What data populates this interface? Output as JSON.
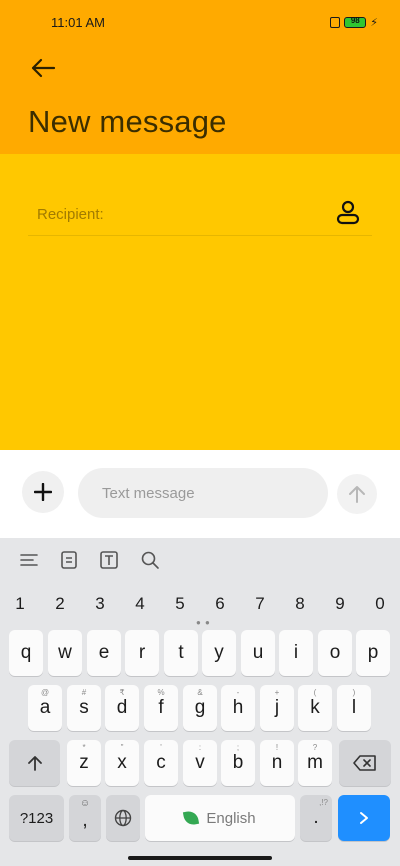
{
  "status_bar": {
    "time": "11:01 AM",
    "battery": "98"
  },
  "header": {
    "title": "New message"
  },
  "recipient": {
    "label": "Recipient:"
  },
  "composer": {
    "placeholder": "Text message"
  },
  "keyboard": {
    "numbers": [
      "1",
      "2",
      "3",
      "4",
      "5",
      "6",
      "7",
      "8",
      "9",
      "0"
    ],
    "row1": [
      "q",
      "w",
      "e",
      "r",
      "t",
      "y",
      "u",
      "i",
      "o",
      "p"
    ],
    "row2": [
      "a",
      "s",
      "d",
      "f",
      "g",
      "h",
      "j",
      "k",
      "l"
    ],
    "row2_hints": [
      "@",
      "#",
      "₹",
      "%",
      "&",
      "-",
      "+",
      "(",
      ")"
    ],
    "row3": [
      "z",
      "x",
      "c",
      "v",
      "b",
      "n",
      "m"
    ],
    "row3_hints": [
      "*",
      "\"",
      "'",
      ":",
      ";",
      "!",
      "?"
    ],
    "symbols_label": "?123",
    "comma": ",",
    "space_label": "English",
    "period": ".",
    "period_hint": ",!?"
  },
  "colors": {
    "header": "#ffaa00",
    "body": "#ffc800",
    "enter": "#1f8fff"
  }
}
